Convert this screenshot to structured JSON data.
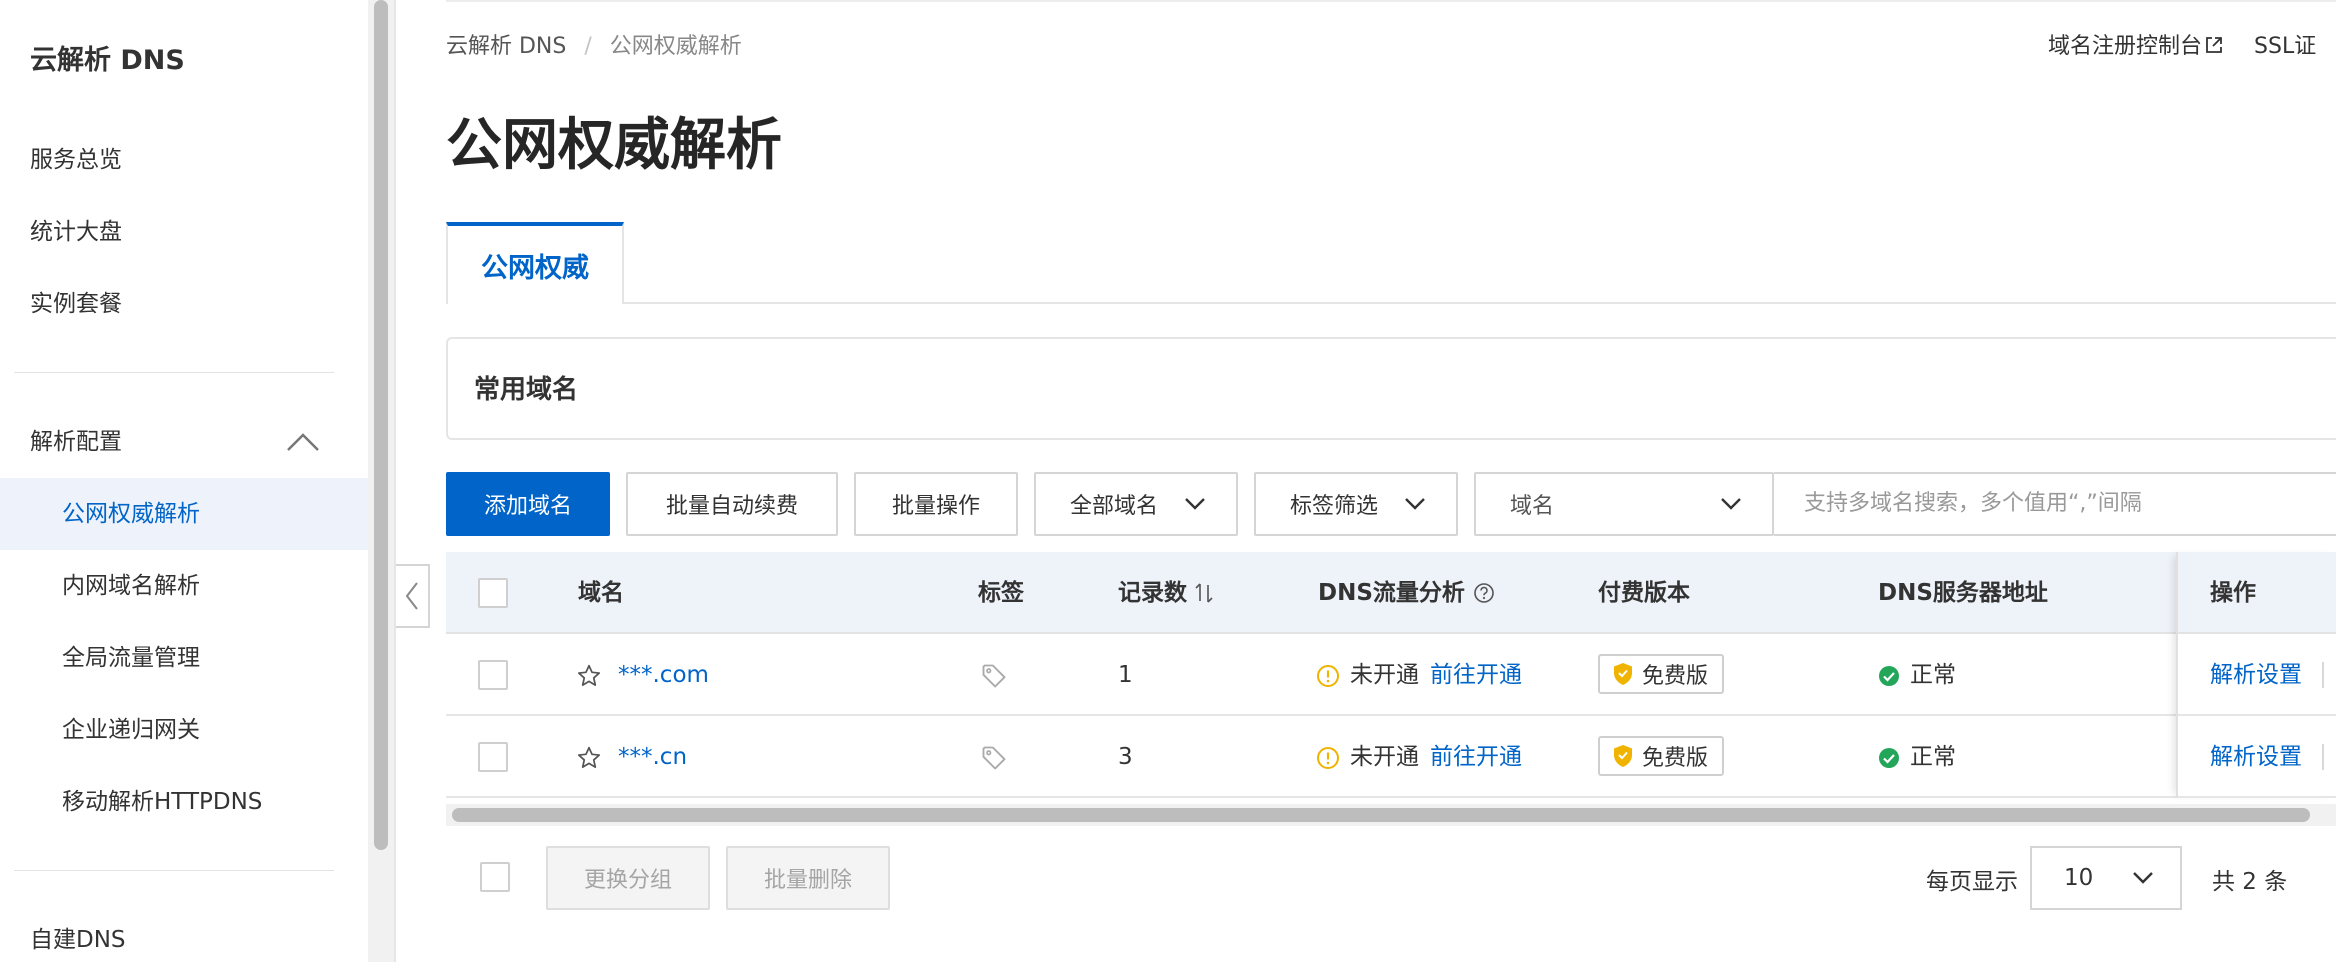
{
  "sidebar": {
    "title": "云解析 DNS",
    "top_items": [
      "服务总览",
      "统计大盘",
      "实例套餐"
    ],
    "group_label": "解析配置",
    "sub_items": [
      "公网权威解析",
      "内网域名解析",
      "全局流量管理",
      "企业递归网关",
      "移动解析HTTPDNS"
    ],
    "bottom_item": "自建DNS"
  },
  "breadcrumb": {
    "root": "云解析 DNS",
    "sep": "/",
    "current": "公网权威解析"
  },
  "top_links": {
    "link1": "域名注册控制台",
    "link2": "SSL证"
  },
  "page_title": "公网权威解析",
  "tab": {
    "label": "公网权威"
  },
  "card": {
    "title": "常用域名"
  },
  "toolbar": {
    "add_domain": "添加域名",
    "batch_renew": "批量自动续费",
    "batch_ops": "批量操作",
    "all_domains": "全部域名",
    "tag_filter": "标签筛选",
    "search_type": "域名",
    "search_placeholder": "支持多域名搜索，多个值用“,”间隔"
  },
  "table": {
    "headers": {
      "domain": "域名",
      "tags": "标签",
      "records": "记录数",
      "dns_traffic": "DNS流量分析",
      "edition": "付费版本",
      "dns_server": "DNS服务器地址",
      "ops": "操作"
    },
    "rows": [
      {
        "domain": "***.com",
        "records": "1",
        "traffic_status": "未开通",
        "traffic_link": "前往开通",
        "edition": "免费版",
        "dns_status": "正常",
        "op": "解析设置"
      },
      {
        "domain": "***.cn",
        "records": "3",
        "traffic_status": "未开通",
        "traffic_link": "前往开通",
        "edition": "免费版",
        "dns_status": "正常",
        "op": "解析设置"
      }
    ]
  },
  "footer": {
    "change_group": "更换分组",
    "batch_delete": "批量删除",
    "per_page_label": "每页显示",
    "per_page_value": "10",
    "total": "共 2 条"
  },
  "colors": {
    "primary": "#0064c8",
    "success": "#23a55a",
    "warning": "#f0b400"
  },
  "icons": [
    "chevron-up-icon",
    "chevron-left-icon",
    "chevron-down-icon",
    "external-link-icon",
    "sort-icon",
    "help-icon",
    "star-icon",
    "tag-icon",
    "warning-icon",
    "shield-icon",
    "check-circle-icon"
  ]
}
